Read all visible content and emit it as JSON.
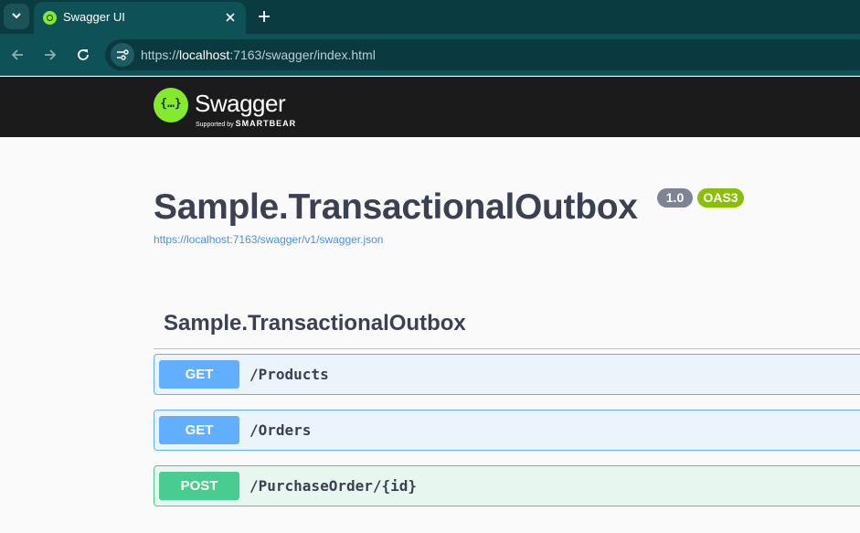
{
  "browser": {
    "tab_title": "Swagger UI",
    "url_prefix": "https://",
    "url_host": "localhost",
    "url_rest": ":7163/swagger/index.html"
  },
  "swagger": {
    "logo_text": "Swagger",
    "supported_by": "Supported by",
    "brand": "SMARTBEAR"
  },
  "info": {
    "title": "Sample.TransactionalOutbox",
    "version": "1.0",
    "oas": "OAS3",
    "spec_url": "https://localhost:7163/swagger/v1/swagger.json"
  },
  "tag": {
    "name": "Sample.TransactionalOutbox"
  },
  "operations": [
    {
      "method": "GET",
      "path": "/Products"
    },
    {
      "method": "GET",
      "path": "/Orders"
    },
    {
      "method": "POST",
      "path": "/PurchaseOrder/{id}"
    }
  ],
  "colors": {
    "chrome_bg": "#0a3b40",
    "swagger_green": "#85ea2d",
    "get_blue": "#61affe",
    "post_green": "#49cc90",
    "text": "#3b4151"
  },
  "icons": [
    "chevron-down-icon",
    "swagger-favicon-icon",
    "close-icon",
    "plus-icon",
    "back-arrow-icon",
    "forward-arrow-icon",
    "reload-icon",
    "site-settings-icon",
    "swagger-logo-icon"
  ]
}
